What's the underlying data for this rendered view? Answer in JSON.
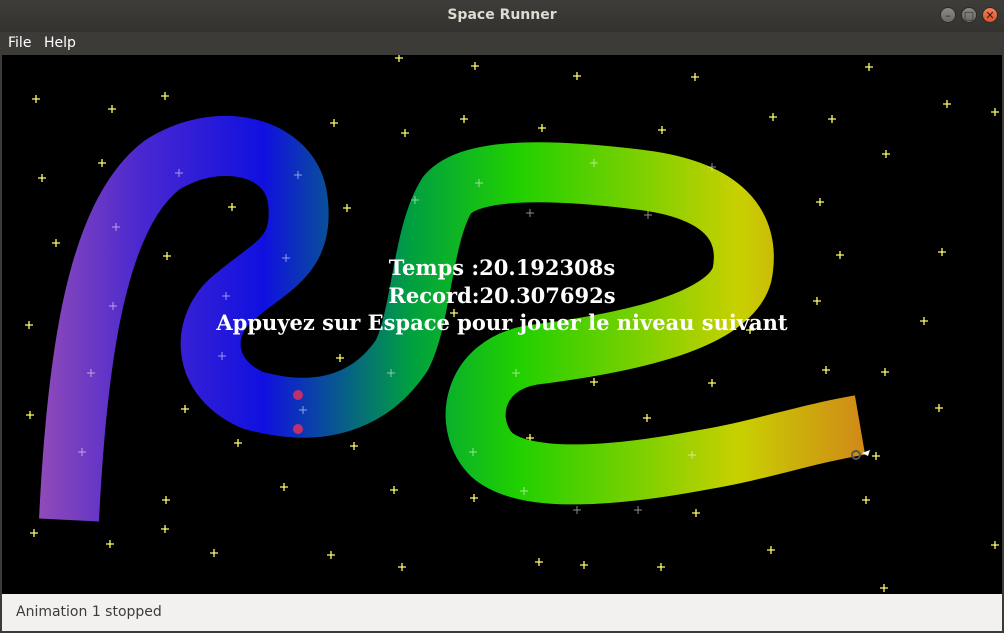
{
  "window": {
    "title": "Space Runner",
    "controls": [
      "minimize-icon",
      "maximize-icon",
      "close-icon"
    ]
  },
  "menu": {
    "file": "File",
    "help": "Help"
  },
  "game": {
    "time_line": "Temps :20.192308s",
    "record_line": "Record:20.307692s",
    "instruction_line": "Appuyez sur Espace pour jouer le niveau suivant",
    "track_colors": [
      "#8e4ab8",
      "#4a28d0",
      "#1010e0",
      "#00a040",
      "#20d000",
      "#c8d000",
      "#d08a18"
    ],
    "star_color": "#ffff66",
    "background_color": "#000000"
  },
  "status": {
    "message": "Animation 1 stopped"
  }
}
